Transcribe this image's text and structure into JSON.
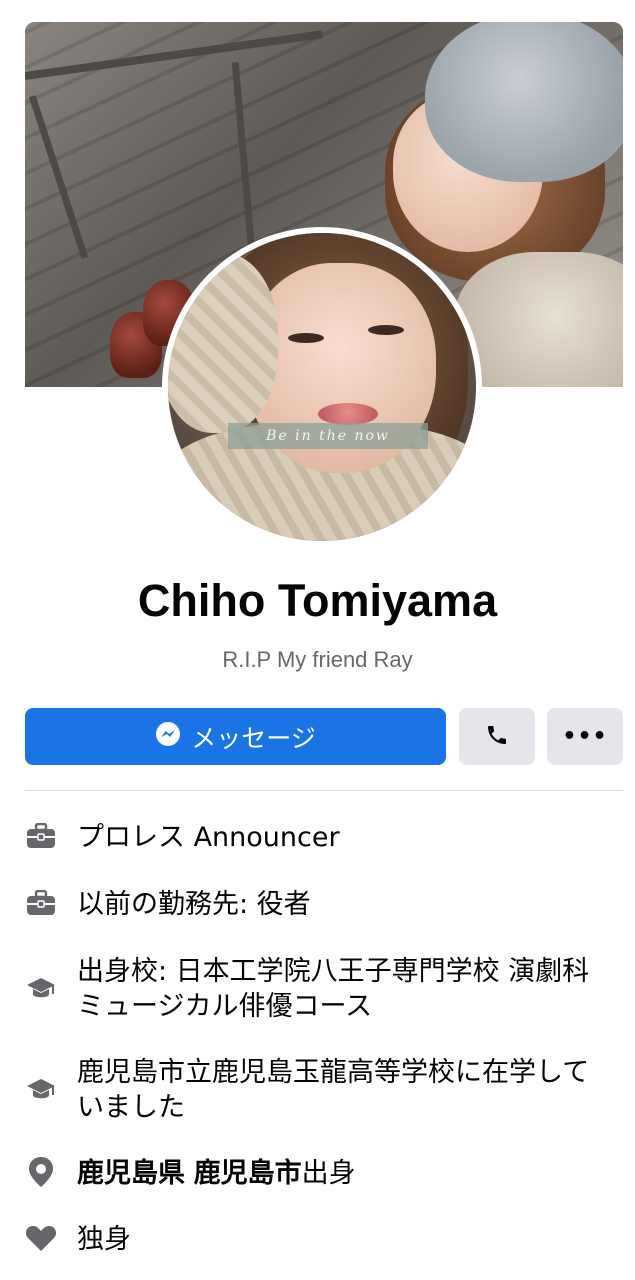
{
  "profile": {
    "name": "Chiho Tomiyama",
    "bio": "R.I.P My friend Ray",
    "avatar_caption": "Be in the now"
  },
  "actions": {
    "message_label": "メッセージ",
    "call_icon": "phone-icon",
    "more_label": "•••",
    "accent": "#1b74e4"
  },
  "details": {
    "work": "プロレス Announcer",
    "past_work": "以前の勤務先: 役者",
    "education": "出身校: 日本工学院八王子専門学校 演劇科ミュージカル俳優コース",
    "high_school": "鹿児島市立鹿児島玉龍高等学校に在学していました",
    "hometown_prefecture": "鹿児島県",
    "hometown_city": "鹿児島市",
    "hometown_suffix": "出身",
    "relationship": "独身"
  }
}
